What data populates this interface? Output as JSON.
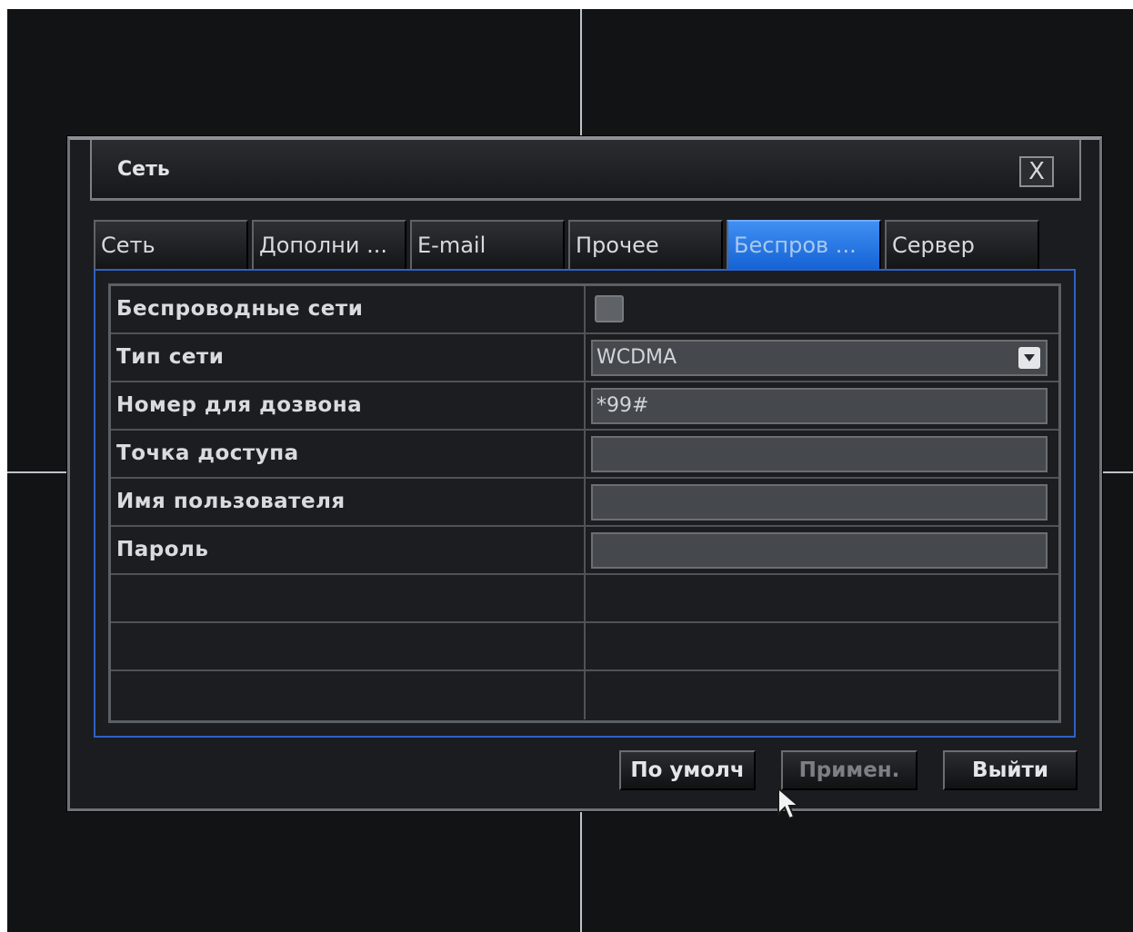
{
  "dialog": {
    "title": "Сеть",
    "close_label": "X"
  },
  "tabs": [
    {
      "label": "Сеть",
      "active": false
    },
    {
      "label": "Дополни ...",
      "active": false
    },
    {
      "label": "E-mail",
      "active": false
    },
    {
      "label": "Прочее",
      "active": false
    },
    {
      "label": "Беспров ...",
      "active": true
    },
    {
      "label": "Сервер",
      "active": false
    }
  ],
  "form": {
    "wireless": {
      "label": "Беспроводные сети",
      "checked": false
    },
    "network_type": {
      "label": "Тип сети",
      "value": "WCDMA"
    },
    "dial_number": {
      "label": "Номер для дозвона",
      "value": "*99#"
    },
    "access_point": {
      "label": "Точка доступа",
      "value": ""
    },
    "username": {
      "label": "Имя пользователя",
      "value": ""
    },
    "password": {
      "label": "Пароль",
      "value": ""
    }
  },
  "buttons": {
    "default": "По умолч",
    "apply": "Примен.",
    "exit": "Выйти"
  },
  "colors": {
    "active_tab": "#1f6fe0",
    "panel_border": "#2f61c7",
    "background": "#121315"
  }
}
